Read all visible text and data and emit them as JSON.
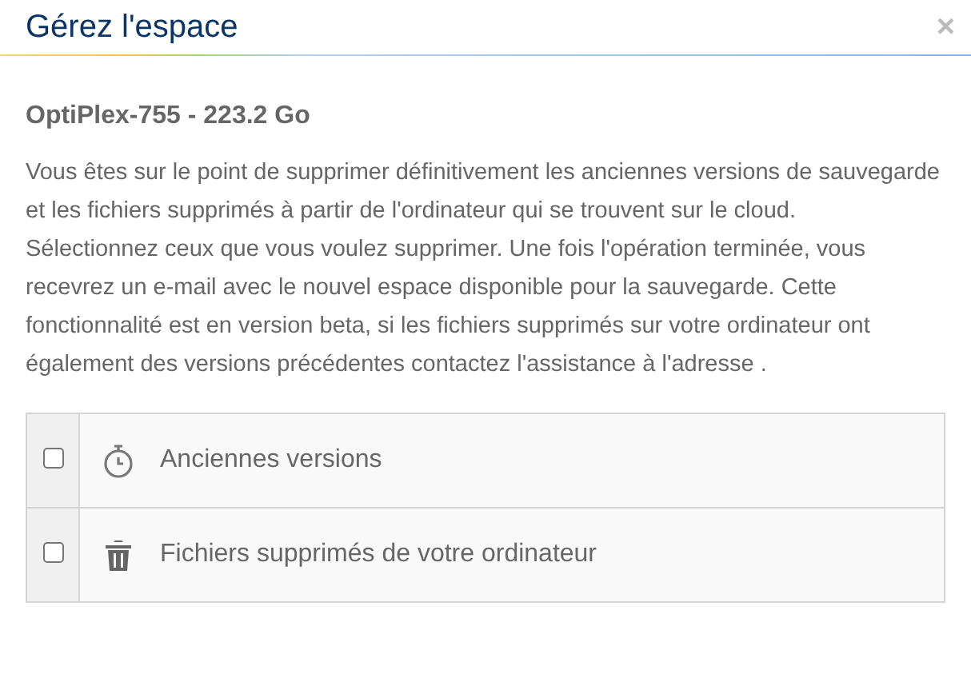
{
  "dialog": {
    "title": "Gérez l'espace",
    "close": "×"
  },
  "device": "OptiPlex-755 - 223.2 Go",
  "paragraphs": [
    "Vous êtes sur le point de supprimer définitivement les anciennes versions de sauvegarde et les fichiers supprimés à partir de l'ordinateur qui se trouvent sur le cloud.",
    "Sélectionnez ceux que vous voulez supprimer. Une fois l'opération terminée, vous recevrez un e-mail avec le nouvel espace disponible pour la sauvegarde. Cette fonctionnalité est en version beta, si les fichiers supprimés sur votre ordinateur ont également des versions précédentes contactez l'assistance à l'adresse ."
  ],
  "options": [
    {
      "label": "Anciennes versions",
      "checked": false
    },
    {
      "label": "Fichiers supprimés de votre ordinateur",
      "checked": false
    }
  ]
}
